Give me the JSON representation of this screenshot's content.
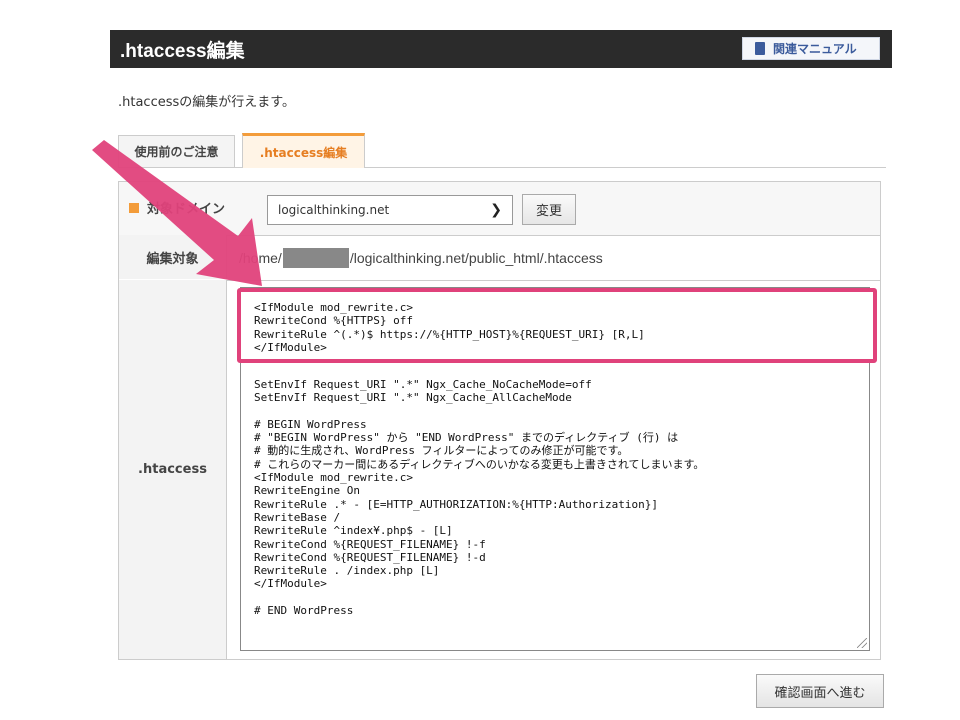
{
  "header": {
    "title": ".htaccess編集",
    "manual_button": "関連マニュアル"
  },
  "description": ".htaccessの編集が行えます。",
  "tabs": [
    {
      "label": "使用前のご注意"
    },
    {
      "label": ".htaccess編集"
    }
  ],
  "domain_row": {
    "label": "対象ドメイン",
    "selected": "logicalthinking.net",
    "change_button": "変更"
  },
  "path_row": {
    "label": "編集対象",
    "path_prefix": "/home/",
    "path_suffix": "/logicalthinking.net/public_html/.htaccess"
  },
  "editor": {
    "label": ".htaccess",
    "highlighted_code": "<IfModule mod_rewrite.c>\nRewriteCond %{HTTPS} off\nRewriteRule ^(.*)$ https://%{HTTP_HOST}%{REQUEST_URI} [R,L]\n</IfModule>",
    "code": "SetEnvIf Request_URI \".*\" Ngx_Cache_NoCacheMode=off\nSetEnvIf Request_URI \".*\" Ngx_Cache_AllCacheMode\n\n# BEGIN WordPress\n# \"BEGIN WordPress\" から \"END WordPress\" までのディレクティブ (行) は\n# 動的に生成され、WordPress フィルターによってのみ修正が可能です。\n# これらのマーカー間にあるディレクティブへのいかなる変更も上書きされてしまいます。\n<IfModule mod_rewrite.c>\nRewriteEngine On\nRewriteRule .* - [E=HTTP_AUTHORIZATION:%{HTTP:Authorization}]\nRewriteBase /\nRewriteRule ^index¥.php$ - [L]\nRewriteCond %{REQUEST_FILENAME} !-f\nRewriteCond %{REQUEST_FILENAME} !-d\nRewriteRule . /index.php [L]\n</IfModule>\n\n# END WordPress"
  },
  "next_button": "確認画面へ進む",
  "colors": {
    "highlight": "#e0427b",
    "accent": "#f39c3a",
    "header_bg": "#2b2b2b"
  }
}
